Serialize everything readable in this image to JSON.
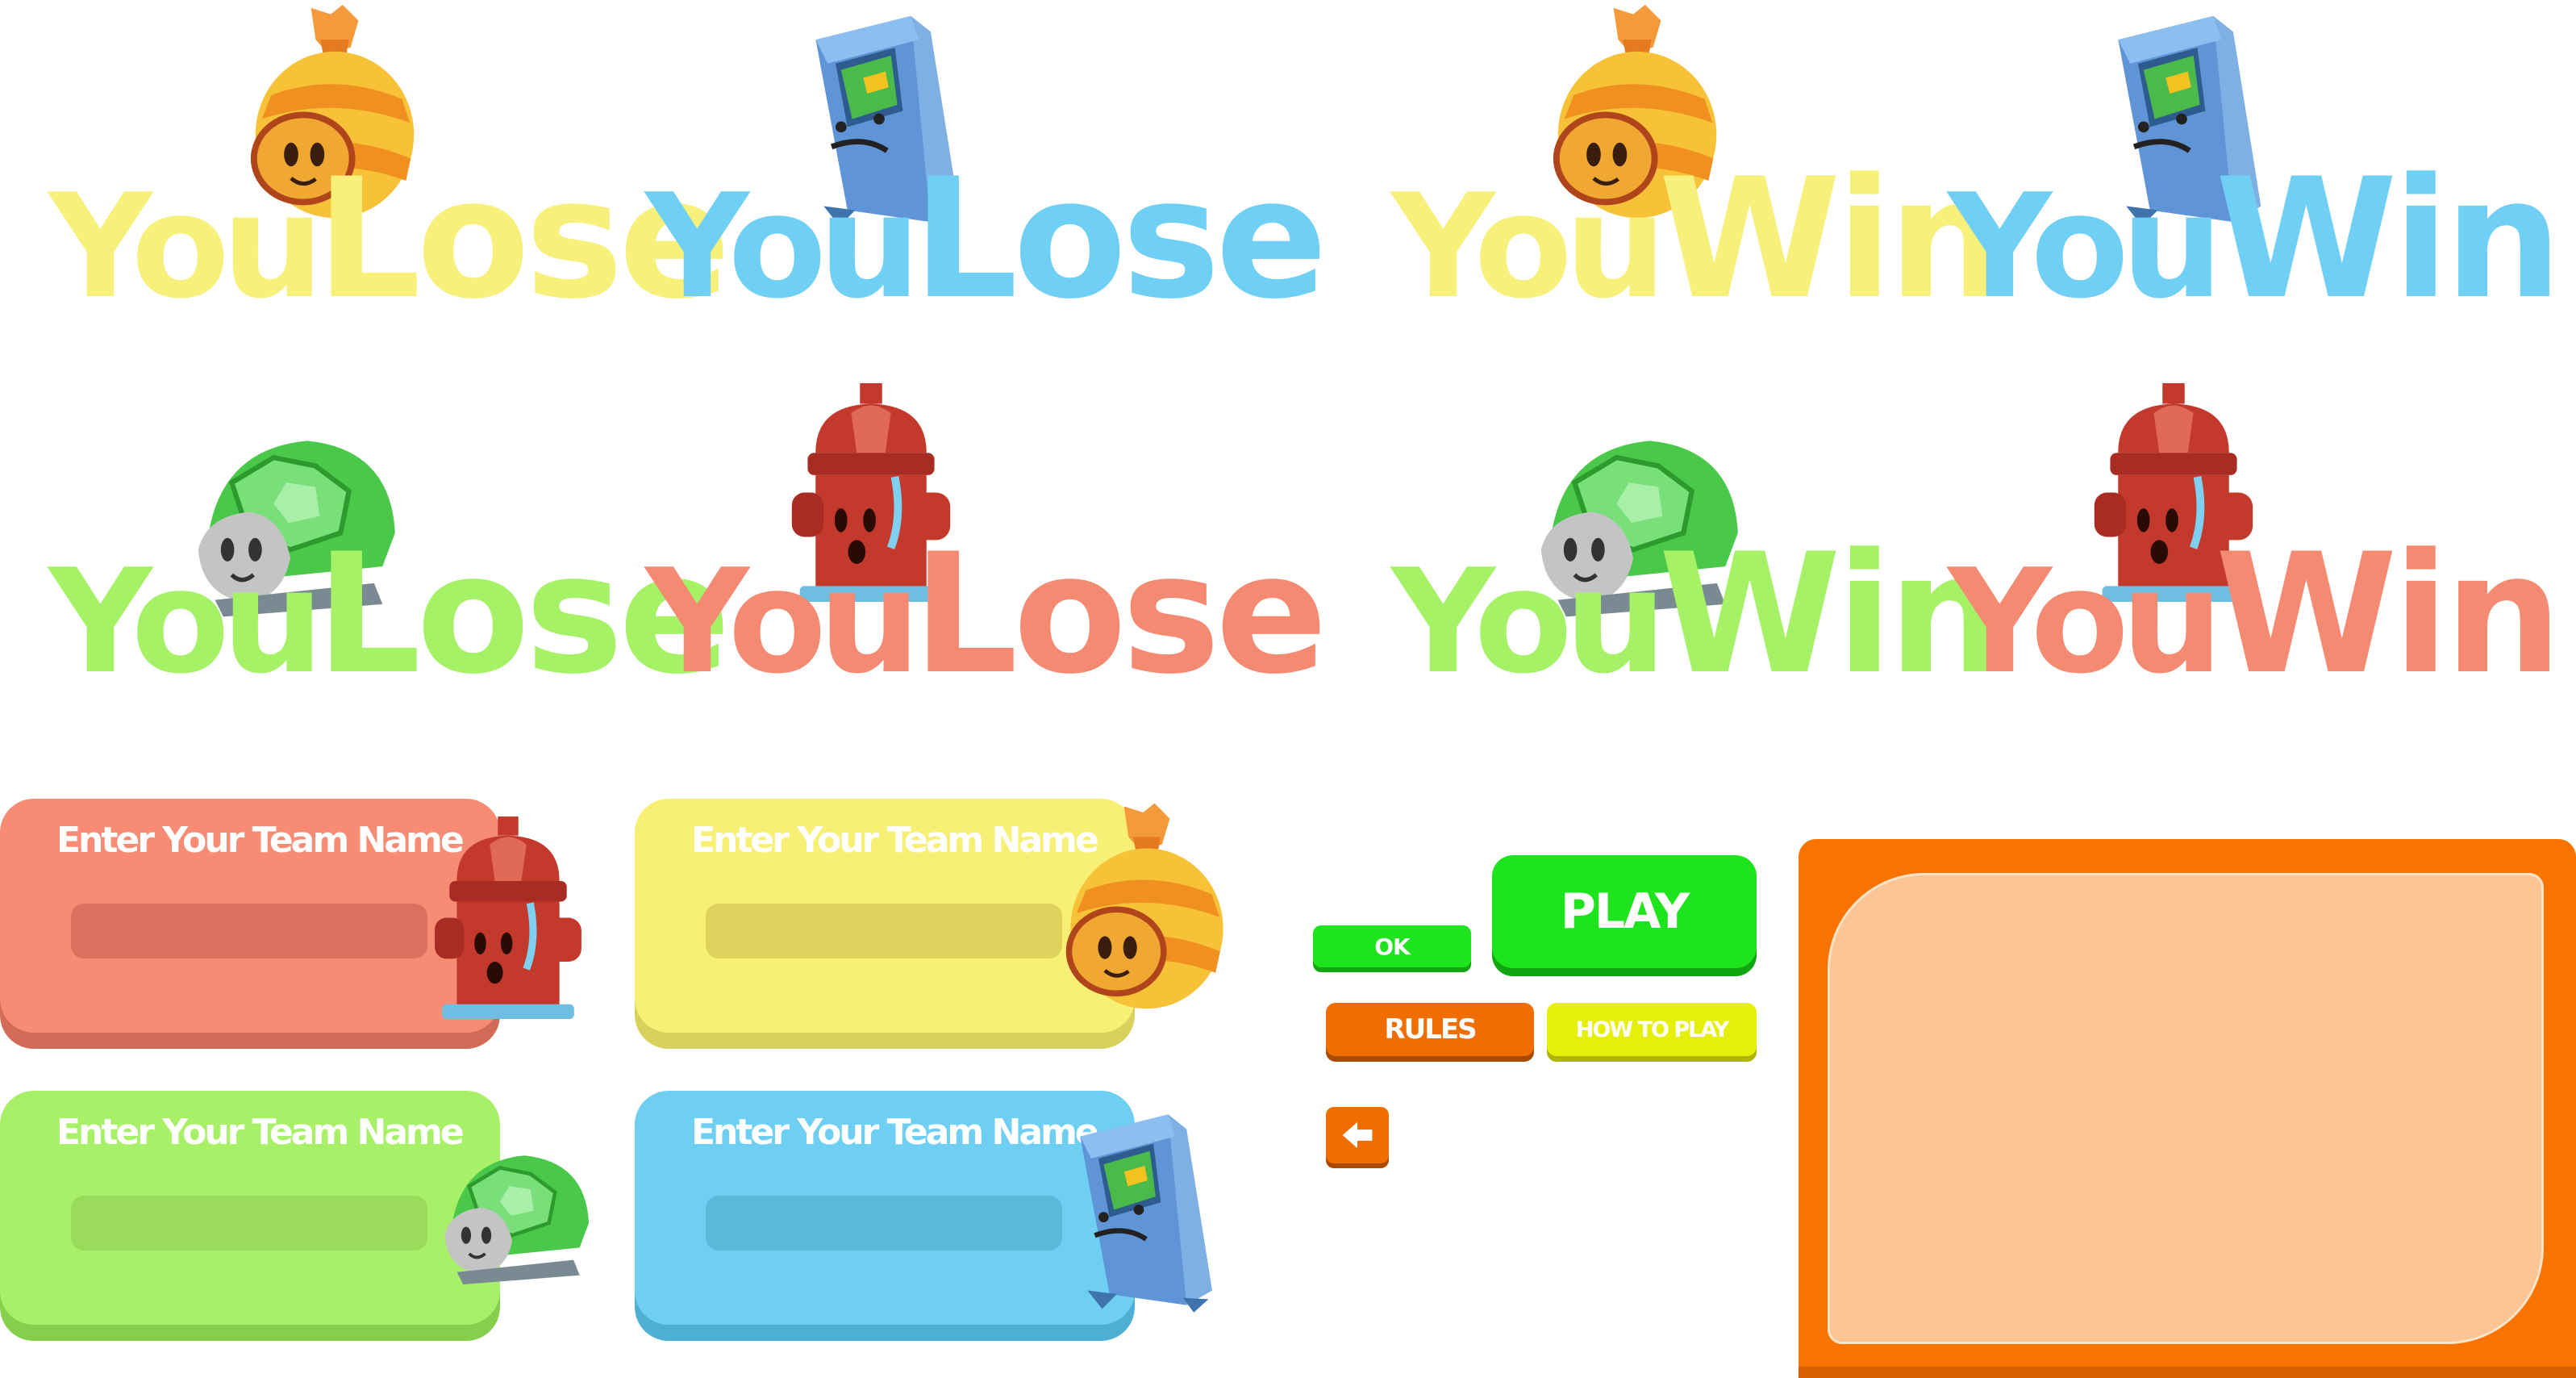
{
  "logos": [
    {
      "id": "lose-yellow",
      "w1": "You",
      "w2": "Lose",
      "color": "#f7f07a"
    },
    {
      "id": "lose-blue",
      "w1": "You",
      "w2": "Lose",
      "color": "#6fcff5"
    },
    {
      "id": "win-yellow",
      "w1": "You",
      "w2": "Win",
      "color": "#f7f07a"
    },
    {
      "id": "win-blue",
      "w1": "You",
      "w2": "Win",
      "color": "#6fcff5"
    },
    {
      "id": "lose-green",
      "w1": "You",
      "w2": "Lose",
      "color": "#a5f266"
    },
    {
      "id": "lose-red",
      "w1": "You",
      "w2": "Lose",
      "color": "#f48a72"
    },
    {
      "id": "win-green",
      "w1": "You",
      "w2": "Win",
      "color": "#a5f266"
    },
    {
      "id": "win-red",
      "w1": "You",
      "w2": "Win",
      "color": "#f48a72"
    }
  ],
  "cards": [
    {
      "id": "red",
      "title": "Enter Your Team Name",
      "body": "#f78b74",
      "shadow": "#d16a57",
      "field": "#dc715f"
    },
    {
      "id": "yellow",
      "title": "Enter Your Team Name",
      "body": "#f7f075",
      "shadow": "#d8d25c",
      "field": "#ddd35d"
    },
    {
      "id": "green",
      "title": "Enter Your Team Name",
      "body": "#a8f068",
      "shadow": "#86cf4c",
      "field": "#9adb5c"
    },
    {
      "id": "blue",
      "title": "Enter Your Team Name",
      "body": "#6ecff3",
      "shadow": "#4eafd4",
      "field": "#5ab8d9"
    }
  ],
  "buttons": {
    "ok": "OK",
    "play": "PLAY",
    "rules": "RULES",
    "how_to_play": "HOW TO PLAY"
  },
  "colors": {
    "green_btn": "#1ee41e",
    "green_btn_shadow": "#11a611",
    "orange_btn": "#f06d00",
    "orange_btn_shadow": "#a94a00",
    "yellow_btn": "#e5ef0a",
    "panel_frame": "#f97300",
    "panel_inner": "#fbc595"
  },
  "icons": {
    "back": "arrow-left-icon"
  }
}
